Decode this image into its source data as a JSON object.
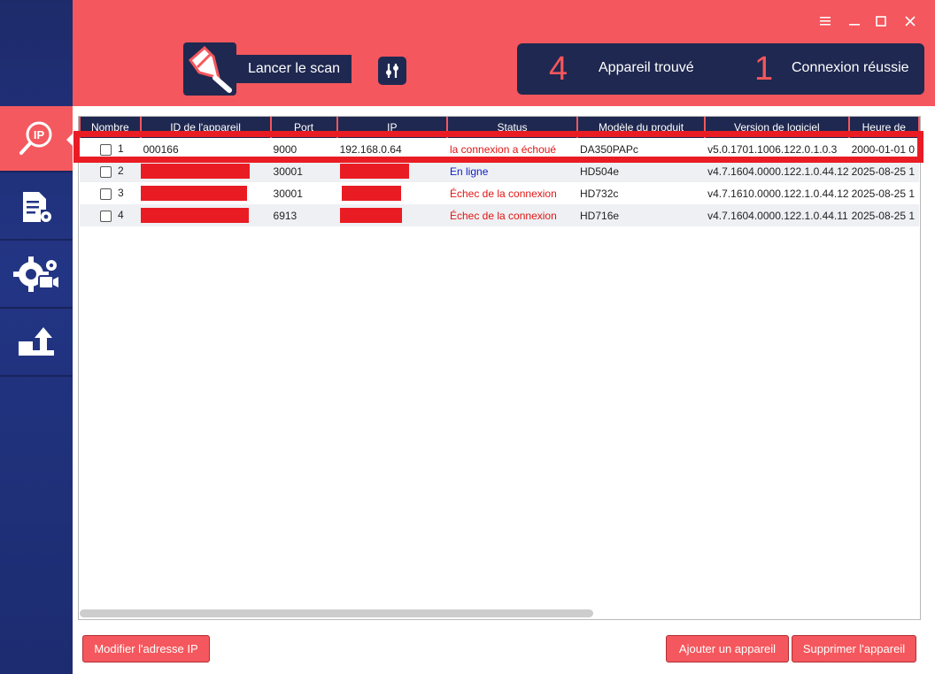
{
  "window": {
    "controls": [
      "menu-icon",
      "minimize-icon",
      "maximize-icon",
      "close-icon"
    ]
  },
  "sidebar": {
    "items": [
      {
        "name": "ip-search",
        "icon": "ip-search-icon",
        "active": true
      },
      {
        "name": "document-settings",
        "icon": "document-gear-icon",
        "active": false
      },
      {
        "name": "camera-settings",
        "icon": "gear-camera-icon",
        "active": false
      },
      {
        "name": "upload",
        "icon": "upload-icon",
        "active": false
      }
    ]
  },
  "header": {
    "scan_label": "Lancer le scan",
    "found_count": "4",
    "found_label": "Appareil trouvé",
    "success_count": "1",
    "success_label": "Connexion réussie"
  },
  "table": {
    "columns": [
      "Nombre",
      "ID de l'appareil",
      "Port",
      "IP",
      "Status",
      "Modèle du produit",
      "Version de logiciel",
      "Heure de"
    ],
    "rows": [
      {
        "num": "1",
        "id": "000166",
        "port": "9000",
        "ip": "192.168.0.64",
        "status": "la connexion a échoué",
        "status_type": "fail",
        "model": "DA350PAPc",
        "version": "v5.0.1701.1006.122.0.1.0.3",
        "time": "2000-01-01 0"
      },
      {
        "num": "2",
        "id": "",
        "port": "30001",
        "ip": "",
        "status": "En ligne",
        "status_type": "online",
        "model": "HD504e",
        "version": "v4.7.1604.0000.122.1.0.44.12",
        "time": "2025-08-25 1"
      },
      {
        "num": "3",
        "id": "",
        "port": "30001",
        "ip": "",
        "status": "Échec de la connexion",
        "status_type": "fail",
        "model": "HD732c",
        "version": "v4.7.1610.0000.122.1.0.44.12",
        "time": "2025-08-25 1"
      },
      {
        "num": "4",
        "id": "",
        "port": "6913",
        "ip": "",
        "status": "Échec de la connexion",
        "status_type": "fail",
        "model": "HD716e",
        "version": "v4.7.1604.0000.122.1.0.44.11",
        "time": "2025-08-25 1"
      }
    ]
  },
  "buttons": {
    "modify_ip": "Modifier l'adresse IP",
    "add_device": "Ajouter un appareil",
    "delete_device": "Supprimer l'appareil"
  },
  "colors": {
    "accent": "#f4575d",
    "navy": "#1f2850",
    "sidebar": "#223584",
    "fail": "#e01616",
    "online": "#1420c8"
  }
}
